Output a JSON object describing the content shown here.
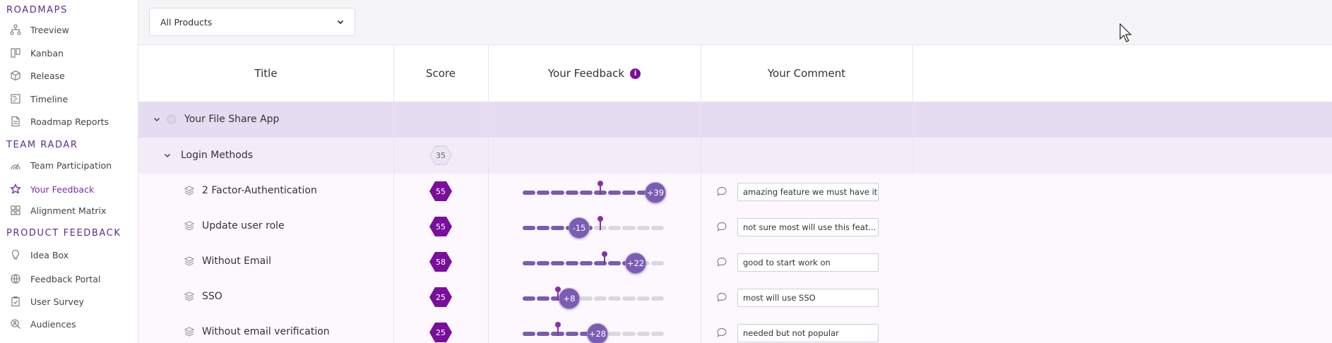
{
  "sidebar": {
    "sections": [
      {
        "title": "ROADMAPS"
      },
      {
        "title": "TEAM RADAR"
      },
      {
        "title": "PRODUCT FEEDBACK"
      }
    ],
    "items": [
      {
        "label": "Treeview",
        "icon": "tree-icon"
      },
      {
        "label": "Kanban",
        "icon": "kanban-icon"
      },
      {
        "label": "Release",
        "icon": "cube-icon"
      },
      {
        "label": "Timeline",
        "icon": "timeline-icon"
      },
      {
        "label": "Roadmap Reports",
        "icon": "document-icon"
      },
      {
        "label": "Team Participation",
        "icon": "radar-icon"
      },
      {
        "label": "Your Feedback",
        "icon": "star-icon",
        "active": true
      },
      {
        "label": "Alignment Matrix",
        "icon": "grid-icon"
      },
      {
        "label": "Idea Box",
        "icon": "lightbulb-icon"
      },
      {
        "label": "Feedback Portal",
        "icon": "globe-icon"
      },
      {
        "label": "User Survey",
        "icon": "clipboard-icon"
      },
      {
        "label": "Audiences",
        "icon": "search-user-icon"
      }
    ]
  },
  "toolbar": {
    "product_select": "All Products"
  },
  "table": {
    "headers": {
      "title": "Title",
      "score": "Score",
      "feedback": "Your Feedback",
      "comment": "Your Comment"
    },
    "group": {
      "title": "Your File Share App"
    },
    "subgroup": {
      "title": "Login Methods",
      "score": "35"
    },
    "rows": [
      {
        "title": "2 Factor-Authentication",
        "score": "55",
        "feedback": "+39",
        "value": 39,
        "pin": 55,
        "comment": "amazing feature we must have it."
      },
      {
        "title": "Update user role",
        "score": "55",
        "feedback": "-15",
        "value": -15,
        "pin": 55,
        "comment": "not sure most will use this feat..."
      },
      {
        "title": "Without Email",
        "score": "58",
        "feedback": "+22",
        "value": 22,
        "pin": 58,
        "comment": "good to start work on"
      },
      {
        "title": "SSO",
        "score": "25",
        "feedback": "+8",
        "value": 8,
        "pin": 25,
        "comment": "most will use SSO"
      },
      {
        "title": "Without email verification",
        "score": "25",
        "feedback": "+28",
        "value": 28,
        "pin": 25,
        "comment": "needed but not popular"
      }
    ]
  },
  "colors": {
    "accent": "#7a0e9c",
    "slider": "#7a5bb0",
    "group_bg": "#e6dcf1",
    "subgroup_bg": "#f3ecf8"
  }
}
